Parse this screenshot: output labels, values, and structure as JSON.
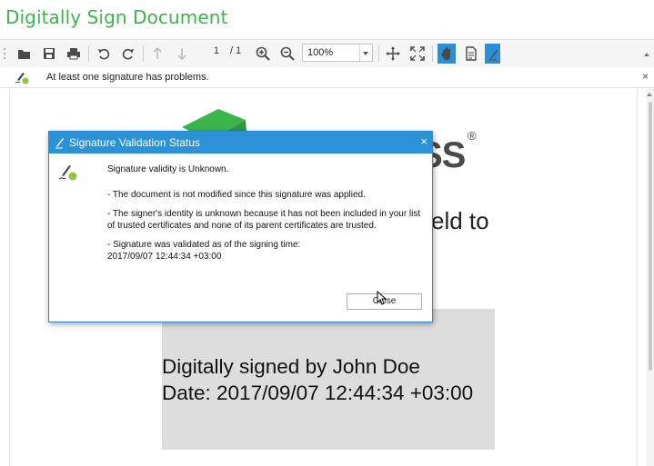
{
  "app": {
    "title": "Digitally Sign Document"
  },
  "toolbar": {
    "page_current": "1",
    "page_total": "/ 1",
    "zoom": "100%",
    "icons": [
      "open-icon",
      "save-icon",
      "print-icon",
      "undo-icon",
      "redo-icon",
      "previous-page-icon",
      "next-page-icon",
      "zoom-in-icon",
      "zoom-out-icon",
      "pan-icon",
      "fit-icon",
      "hand-tool-icon",
      "document-properties-icon",
      "signature-icon"
    ],
    "active_color": "#2b8fd6"
  },
  "notice": {
    "text": "At least one signature has problems.",
    "close": "×"
  },
  "document": {
    "logo_text": "SS",
    "logo_reg": "®",
    "fragment": "eld to",
    "mark": "t",
    "signature_line1": "Digitally signed by John Doe",
    "signature_line2": "Date: 2017/09/07 12:44:34 +03:00"
  },
  "dialog": {
    "title": "Signature Validation Status",
    "close": "×",
    "validity": "Signature validity is Unknown.",
    "not_modified": "- The document is not modified since this signature was applied.",
    "identity": "- The signer's identity is unknown because it has not been included in your list of trusted certificates and none of its parent certificates are trusted.",
    "validated_as_of": "- Signature was validated as of the signing time:",
    "signing_time": "2017/09/07 12:44:34 +03:00",
    "close_button": "Close"
  },
  "colors": {
    "title_green": "#3bb54a",
    "dialog_header": "#2b92d8",
    "signature_field": "#dddddd"
  }
}
